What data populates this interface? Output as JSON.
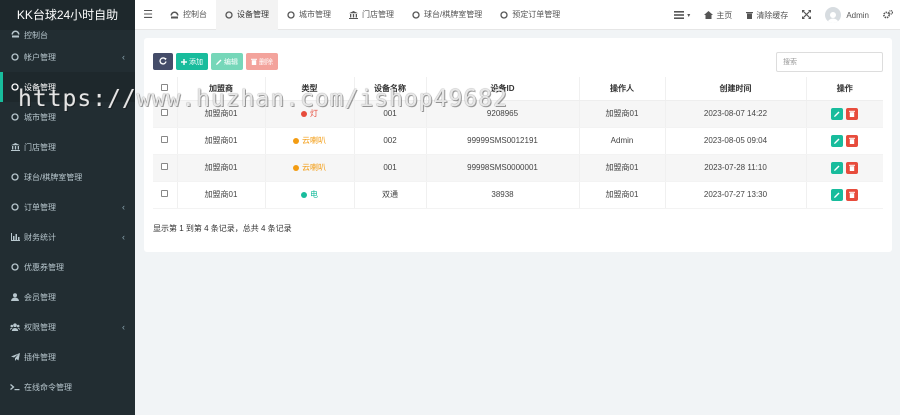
{
  "sidebar": {
    "brand": "KK台球24小时自助",
    "items": [
      {
        "label": "控制台",
        "icon": "dashboard-icon",
        "caret": false
      },
      {
        "label": "帐户管理",
        "icon": "circle-icon",
        "caret": true
      },
      {
        "label": "设备管理",
        "icon": "circle-icon",
        "caret": false,
        "active": true
      },
      {
        "label": "城市管理",
        "icon": "circle-icon",
        "caret": false
      },
      {
        "label": "门店管理",
        "icon": "bank-icon",
        "caret": false
      },
      {
        "label": "球台/棋牌室管理",
        "icon": "circle-icon",
        "caret": false
      },
      {
        "label": "订单管理",
        "icon": "circle-icon",
        "caret": true
      },
      {
        "label": "财务统计",
        "icon": "bar-chart-icon",
        "caret": true
      },
      {
        "label": "优惠券管理",
        "icon": "circle-icon",
        "caret": false
      },
      {
        "label": "会员管理",
        "icon": "user-icon",
        "caret": false
      },
      {
        "label": "权限管理",
        "icon": "group-icon",
        "caret": true
      },
      {
        "label": "插件管理",
        "icon": "paper-plane-icon",
        "caret": false
      },
      {
        "label": "在线命令管理",
        "icon": "terminal-icon",
        "caret": false
      }
    ]
  },
  "topbar": {
    "tabs": [
      {
        "label": "控制台",
        "icon": "dashboard-icon"
      },
      {
        "label": "设备管理",
        "icon": "circle-icon",
        "active": true
      },
      {
        "label": "城市管理",
        "icon": "circle-icon"
      },
      {
        "label": "门店管理",
        "icon": "bank-icon"
      },
      {
        "label": "球台/棋牌室管理",
        "icon": "circle-icon"
      },
      {
        "label": "预定订单管理",
        "icon": "circle-icon"
      }
    ],
    "home_label": "主页",
    "clear_cache_label": "清除缓存",
    "user_name": "Admin"
  },
  "toolbar": {
    "add_label": "添加",
    "edit_label": "编辑",
    "delete_label": "删除",
    "search_placeholder": "搜索"
  },
  "table": {
    "headers": [
      "加盟商",
      "类型",
      "设备名称",
      "设备ID",
      "操作人",
      "创建时间",
      "操作"
    ],
    "rows": [
      {
        "merchant": "加盟商01",
        "type": "灯",
        "type_color": "#e74c3c",
        "name": "001",
        "device_id": "9208965",
        "operator": "加盟商01",
        "created": "2023-08-07 14:22"
      },
      {
        "merchant": "加盟商01",
        "type": "云喇叭",
        "type_color": "#f39c12",
        "name": "002",
        "device_id": "99999SMS0012191",
        "operator": "Admin",
        "created": "2023-08-05 09:04"
      },
      {
        "merchant": "加盟商01",
        "type": "云喇叭",
        "type_color": "#f39c12",
        "name": "001",
        "device_id": "99998SMS0000001",
        "operator": "加盟商01",
        "created": "2023-07-28 11:10"
      },
      {
        "merchant": "加盟商01",
        "type": "电",
        "type_color": "#18bc9c",
        "name": "双通",
        "device_id": "38938",
        "operator": "加盟商01",
        "created": "2023-07-27 13:30"
      }
    ]
  },
  "summary": "显示第 1 到第 4 条记录，总共 4 条记录",
  "watermark": "https://www.huzhan.com/ishop49682",
  "colors": {
    "sidebar_bg": "#222d32",
    "accent": "#18bc9c",
    "danger": "#e74c3c",
    "warning": "#f39c12"
  }
}
